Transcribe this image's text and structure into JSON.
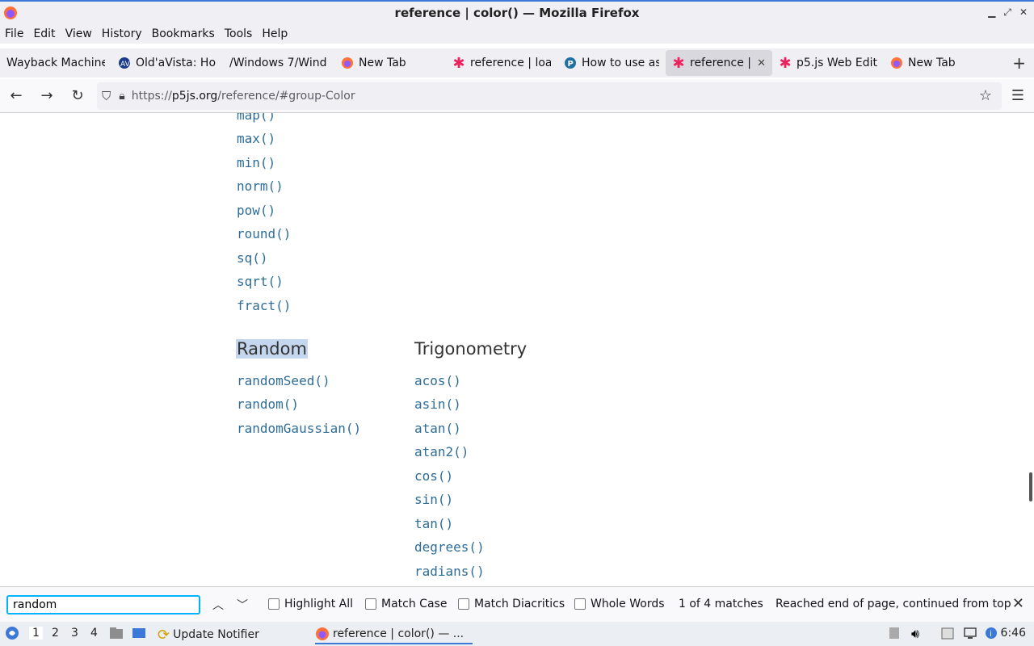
{
  "window": {
    "title": "reference | color() — Mozilla Firefox"
  },
  "menubar": {
    "items": [
      "File",
      "Edit",
      "View",
      "History",
      "Bookmarks",
      "Tools",
      "Help"
    ]
  },
  "tabs": [
    {
      "label": "Wayback Machine",
      "icon": "wayback-icon",
      "active": false
    },
    {
      "label": "Old'aVista: Ho",
      "icon": "altavista-icon",
      "active": false
    },
    {
      "label": "/Windows 7/Wind",
      "icon": "none",
      "active": false
    },
    {
      "label": "New Tab",
      "icon": "firefox-icon",
      "active": false
    },
    {
      "label": "reference | loa",
      "icon": "p5-asterisk-icon",
      "active": false
    },
    {
      "label": "How to use as",
      "icon": "p-circle-icon",
      "active": false
    },
    {
      "label": "reference | c",
      "icon": "p5-asterisk-icon",
      "active": true
    },
    {
      "label": "p5.js Web Edit",
      "icon": "p5-asterisk-icon",
      "active": false
    },
    {
      "label": "New Tab",
      "icon": "firefox-icon",
      "active": false
    }
  ],
  "url": {
    "prefix": "https://",
    "host": "p5js.org",
    "path": "/reference/#group-Color"
  },
  "content": {
    "math_functions": [
      "map()",
      "max()",
      "min()",
      "norm()",
      "pow()",
      "round()",
      "sq()",
      "sqrt()",
      "fract()"
    ],
    "random_heading": "Random",
    "random_functions": [
      "randomSeed()",
      "random()",
      "randomGaussian()"
    ],
    "trig_heading": "Trigonometry",
    "trig_functions": [
      "acos()",
      "asin()",
      "atan()",
      "atan2()",
      "cos()",
      "sin()",
      "tan()",
      "degrees()",
      "radians()"
    ]
  },
  "findbar": {
    "query": "random",
    "highlight_all": "Highlight All",
    "match_case": "Match Case",
    "match_diacritics": "Match Diacritics",
    "whole_words": "Whole Words",
    "match_count": "1 of 4 matches",
    "status": "Reached end of page, continued from top"
  },
  "taskbar": {
    "workspaces": [
      "1",
      "2",
      "3",
      "4"
    ],
    "update_notifier": "Update Notifier",
    "active_task": "reference | color() — ...",
    "clock": "6:46"
  },
  "colors": {
    "link": "#2e6d98",
    "highlight": "#c5d7ef",
    "accent": "#3c78d8"
  }
}
